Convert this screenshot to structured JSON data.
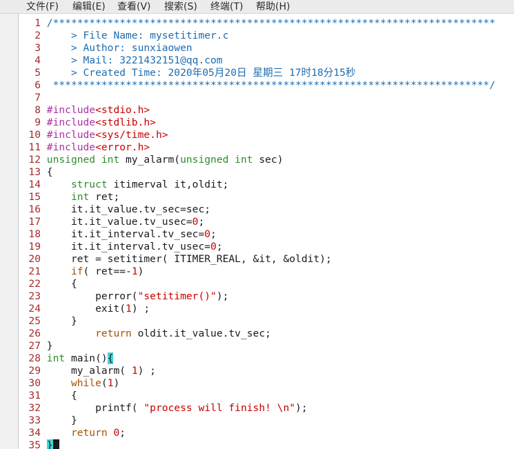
{
  "menu": [
    "文件(F)",
    "编辑(E)",
    "查看(V)",
    "搜索(S)",
    "终端(T)",
    "帮助(H)"
  ],
  "lines": [
    {
      "n": "1",
      "tokens": [
        {
          "t": "/*************************************************************************",
          "c": "comment"
        }
      ]
    },
    {
      "n": "2",
      "tokens": [
        {
          "t": "    > File Name: mysetitimer.c",
          "c": "comment"
        }
      ]
    },
    {
      "n": "3",
      "tokens": [
        {
          "t": "    > Author: sunxiaowen",
          "c": "comment"
        }
      ]
    },
    {
      "n": "4",
      "tokens": [
        {
          "t": "    > Mail: 3221432151@qq.com",
          "c": "comment"
        }
      ]
    },
    {
      "n": "5",
      "tokens": [
        {
          "t": "    > Created Time: 2020年05月20日 星期三 17时18分15秒",
          "c": "comment"
        }
      ]
    },
    {
      "n": "6",
      "tokens": [
        {
          "t": " ************************************************************************/",
          "c": "comment"
        }
      ]
    },
    {
      "n": "7",
      "tokens": []
    },
    {
      "n": "8",
      "tokens": [
        {
          "t": "#include",
          "c": "pre"
        },
        {
          "t": "<stdio.h>",
          "c": "inc"
        }
      ]
    },
    {
      "n": "9",
      "tokens": [
        {
          "t": "#include",
          "c": "pre"
        },
        {
          "t": "<stdlib.h>",
          "c": "inc"
        }
      ]
    },
    {
      "n": "10",
      "tokens": [
        {
          "t": "#include",
          "c": "pre"
        },
        {
          "t": "<sys/time.h>",
          "c": "inc"
        }
      ]
    },
    {
      "n": "11",
      "tokens": [
        {
          "t": "#include",
          "c": "pre"
        },
        {
          "t": "<error.h>",
          "c": "inc"
        }
      ]
    },
    {
      "n": "12",
      "tokens": [
        {
          "t": "unsigned int",
          "c": "type"
        },
        {
          "t": " my_alarm(",
          "c": "norm"
        },
        {
          "t": "unsigned int",
          "c": "type"
        },
        {
          "t": " sec)",
          "c": "norm"
        }
      ]
    },
    {
      "n": "13",
      "tokens": [
        {
          "t": "{",
          "c": "norm"
        }
      ]
    },
    {
      "n": "14",
      "tokens": [
        {
          "t": "    ",
          "c": "norm"
        },
        {
          "t": "struct",
          "c": "type"
        },
        {
          "t": " itimerval it,oldit;",
          "c": "norm"
        }
      ]
    },
    {
      "n": "15",
      "tokens": [
        {
          "t": "    ",
          "c": "norm"
        },
        {
          "t": "int",
          "c": "type"
        },
        {
          "t": " ret;",
          "c": "norm"
        }
      ]
    },
    {
      "n": "16",
      "tokens": [
        {
          "t": "    it.it_value.tv_sec=sec;",
          "c": "norm"
        }
      ]
    },
    {
      "n": "17",
      "tokens": [
        {
          "t": "    it.it_value.tv_usec=",
          "c": "norm"
        },
        {
          "t": "0",
          "c": "num"
        },
        {
          "t": ";",
          "c": "norm"
        }
      ]
    },
    {
      "n": "18",
      "tokens": [
        {
          "t": "    it.it_interval.tv_sec=",
          "c": "norm"
        },
        {
          "t": "0",
          "c": "num"
        },
        {
          "t": ";",
          "c": "norm"
        }
      ]
    },
    {
      "n": "19",
      "tokens": [
        {
          "t": "    it.it_interval.tv_usec=",
          "c": "norm"
        },
        {
          "t": "0",
          "c": "num"
        },
        {
          "t": ";",
          "c": "norm"
        }
      ]
    },
    {
      "n": "20",
      "tokens": [
        {
          "t": "    ret = setitimer( ITIMER_REAL, &it, &oldit);",
          "c": "norm"
        }
      ]
    },
    {
      "n": "21",
      "tokens": [
        {
          "t": "    ",
          "c": "norm"
        },
        {
          "t": "if",
          "c": "kw"
        },
        {
          "t": "( ret==-",
          "c": "norm"
        },
        {
          "t": "1",
          "c": "num"
        },
        {
          "t": ")",
          "c": "norm"
        }
      ]
    },
    {
      "n": "22",
      "tokens": [
        {
          "t": "    {",
          "c": "norm"
        }
      ]
    },
    {
      "n": "23",
      "tokens": [
        {
          "t": "        perror(",
          "c": "norm"
        },
        {
          "t": "\"setitimer()\"",
          "c": "str"
        },
        {
          "t": ");",
          "c": "norm"
        }
      ]
    },
    {
      "n": "24",
      "tokens": [
        {
          "t": "        exit(",
          "c": "norm"
        },
        {
          "t": "1",
          "c": "num"
        },
        {
          "t": ") ;",
          "c": "norm"
        }
      ]
    },
    {
      "n": "25",
      "tokens": [
        {
          "t": "    }",
          "c": "norm"
        }
      ]
    },
    {
      "n": "26",
      "tokens": [
        {
          "t": "        ",
          "c": "norm"
        },
        {
          "t": "return",
          "c": "kw"
        },
        {
          "t": " oldit.it_value.tv_sec;",
          "c": "norm"
        }
      ]
    },
    {
      "n": "27",
      "tokens": [
        {
          "t": "}",
          "c": "norm"
        }
      ]
    },
    {
      "n": "28",
      "tokens": [
        {
          "t": "int",
          "c": "type"
        },
        {
          "t": " main()",
          "c": "norm"
        },
        {
          "t": "{",
          "c": "match"
        }
      ]
    },
    {
      "n": "29",
      "tokens": [
        {
          "t": "    my_alarm( ",
          "c": "norm"
        },
        {
          "t": "1",
          "c": "num"
        },
        {
          "t": ") ;",
          "c": "norm"
        }
      ]
    },
    {
      "n": "30",
      "tokens": [
        {
          "t": "    ",
          "c": "norm"
        },
        {
          "t": "while",
          "c": "kw"
        },
        {
          "t": "(",
          "c": "norm"
        },
        {
          "t": "1",
          "c": "num"
        },
        {
          "t": ")",
          "c": "norm"
        }
      ]
    },
    {
      "n": "31",
      "tokens": [
        {
          "t": "    {",
          "c": "norm"
        }
      ]
    },
    {
      "n": "32",
      "tokens": [
        {
          "t": "        printf( ",
          "c": "norm"
        },
        {
          "t": "\"process will finish! \\n\"",
          "c": "str"
        },
        {
          "t": ");",
          "c": "norm"
        }
      ]
    },
    {
      "n": "33",
      "tokens": [
        {
          "t": "    }",
          "c": "norm"
        }
      ]
    },
    {
      "n": "34",
      "tokens": [
        {
          "t": "    ",
          "c": "norm"
        },
        {
          "t": "return",
          "c": "kw"
        },
        {
          "t": " ",
          "c": "norm"
        },
        {
          "t": "0",
          "c": "num"
        },
        {
          "t": ";",
          "c": "norm"
        }
      ]
    },
    {
      "n": "35",
      "tokens": [
        {
          "t": "}",
          "c": "match"
        },
        {
          "t": "",
          "c": "cursor"
        }
      ]
    }
  ]
}
